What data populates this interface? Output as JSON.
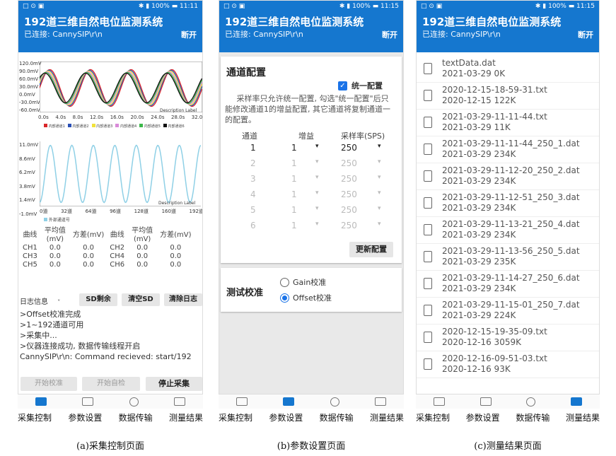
{
  "status": {
    "left": "□ ⊙ ▣",
    "a_right": "✱ ▮ 100% ▬ 11:11",
    "b_right": "✱ ▮ 100% ▬ 11:15",
    "c_right": "✱ ▮ 100% ▬ 11:15"
  },
  "app": {
    "title": "192道三维自然电位监测系统",
    "subtitle": "已连接: CannySIP\\r\\n",
    "disconnect": "断开"
  },
  "tabs": [
    "采集控制",
    "参数设置",
    "数据传输",
    "测量结果"
  ],
  "captions": {
    "a": "(a)采集控制页面",
    "b": "(b)参数设置页面",
    "c": "(c)测量结果页面"
  },
  "panel_a": {
    "chart1": {
      "y_ticks": [
        "120.0mV",
        "90.0mV",
        "60.0mV",
        "30.0mV",
        "0.0mV",
        "-30.0mV",
        "-60.0mV"
      ],
      "x_ticks": [
        "0.0s",
        "4.0s",
        "8.0s",
        "12.0s",
        "16.0s",
        "20.0s",
        "24.0s",
        "28.0s",
        "32.0s"
      ],
      "description": "Description Label",
      "legend": [
        "内部通道1",
        "内部通道2",
        "内部通道3",
        "内部通道4",
        "内部通道5",
        "内部通道6"
      ],
      "legend_colors": [
        "#d9262a",
        "#2a4fb5",
        "#f2e23a",
        "#d98ad9",
        "#3cb84a",
        "#111111"
      ]
    },
    "chart2": {
      "y_ticks": [
        "11.0mV",
        "8.6mV",
        "6.2mV",
        "3.8mV",
        "1.4mV",
        "-1.0mV"
      ],
      "x_ticks": [
        "0道",
        "32道",
        "64道",
        "96道",
        "128道",
        "160道",
        "192道"
      ],
      "description": "Description Label",
      "legend": "外部通道号",
      "color": "#8fd0e6"
    },
    "table": {
      "headers": [
        "曲线",
        "平均值 (mV)",
        "方差(mV)",
        "曲线",
        "平均值 (mV)",
        "方差(mV)"
      ],
      "rows": [
        [
          "CH1",
          "0.0",
          "0.0",
          "CH2",
          "0.0",
          "0.0"
        ],
        [
          "CH3",
          "0.0",
          "0.0",
          "CH4",
          "0.0",
          "0.0"
        ],
        [
          "CH5",
          "0.0",
          "0.0",
          "CH6",
          "0.0",
          "0.0"
        ]
      ]
    },
    "log_label": "日志信息",
    "sd_remain": "SD剩余",
    "clear_sd": "清空SD",
    "clear_log": "清除日志",
    "log_lines": [
      ">Offset校准完成",
      ">1~192通道可用",
      ">采集中...",
      ">仪器连接成功, 数据传输线程开启",
      "CannySIP\\r\\n: Command recieved: start/192"
    ],
    "btn_calib": "开始校准",
    "btn_selfcheck": "开始自检",
    "btn_stop": "停止采集"
  },
  "panel_b": {
    "section_title": "通道配置",
    "unify_label": "统一配置",
    "description": "采样率只允许统一配置, 勾选\"统一配置\"后只能修改通道1的增益配置, 其它通道将复制通道一的配置。",
    "col_headers": [
      "通道",
      "增益",
      "采样率(SPS)"
    ],
    "rows": [
      [
        "1",
        "1",
        "250"
      ],
      [
        "2",
        "1",
        "250"
      ],
      [
        "3",
        "1",
        "250"
      ],
      [
        "4",
        "1",
        "250"
      ],
      [
        "5",
        "1",
        "250"
      ],
      [
        "6",
        "1",
        "250"
      ]
    ],
    "update_btn": "更新配置",
    "calib_title": "测试校准",
    "opt_gain": "Gain校准",
    "opt_offset": "Offset校准"
  },
  "panel_c": {
    "files": [
      {
        "name": "textData.dat",
        "meta": "2021-03-29  0K"
      },
      {
        "name": "2020-12-15-18-59-31.txt",
        "meta": "2020-12-15  122K"
      },
      {
        "name": "2021-03-29-11-11-44.txt",
        "meta": "2021-03-29  11K"
      },
      {
        "name": "2021-03-29-11-11-44_250_1.dat",
        "meta": "2021-03-29  234K"
      },
      {
        "name": "2021-03-29-11-12-20_250_2.dat",
        "meta": "2021-03-29  234K"
      },
      {
        "name": "2021-03-29-11-12-51_250_3.dat",
        "meta": "2021-03-29  234K"
      },
      {
        "name": "2021-03-29-11-13-21_250_4.dat",
        "meta": "2021-03-29  234K"
      },
      {
        "name": "2021-03-29-11-13-56_250_5.dat",
        "meta": "2021-03-29  235K"
      },
      {
        "name": "2021-03-29-11-14-27_250_6.dat",
        "meta": "2021-03-29  234K"
      },
      {
        "name": "2021-03-29-11-15-01_250_7.dat",
        "meta": "2021-03-29  224K"
      },
      {
        "name": "2020-12-15-19-35-09.txt",
        "meta": "2020-12-16  3059K"
      },
      {
        "name": "2020-12-16-09-51-03.txt",
        "meta": "2020-12-16  93K"
      }
    ]
  },
  "colors": {
    "primary": "#1577cf",
    "checkbox": "#1a73e8"
  }
}
